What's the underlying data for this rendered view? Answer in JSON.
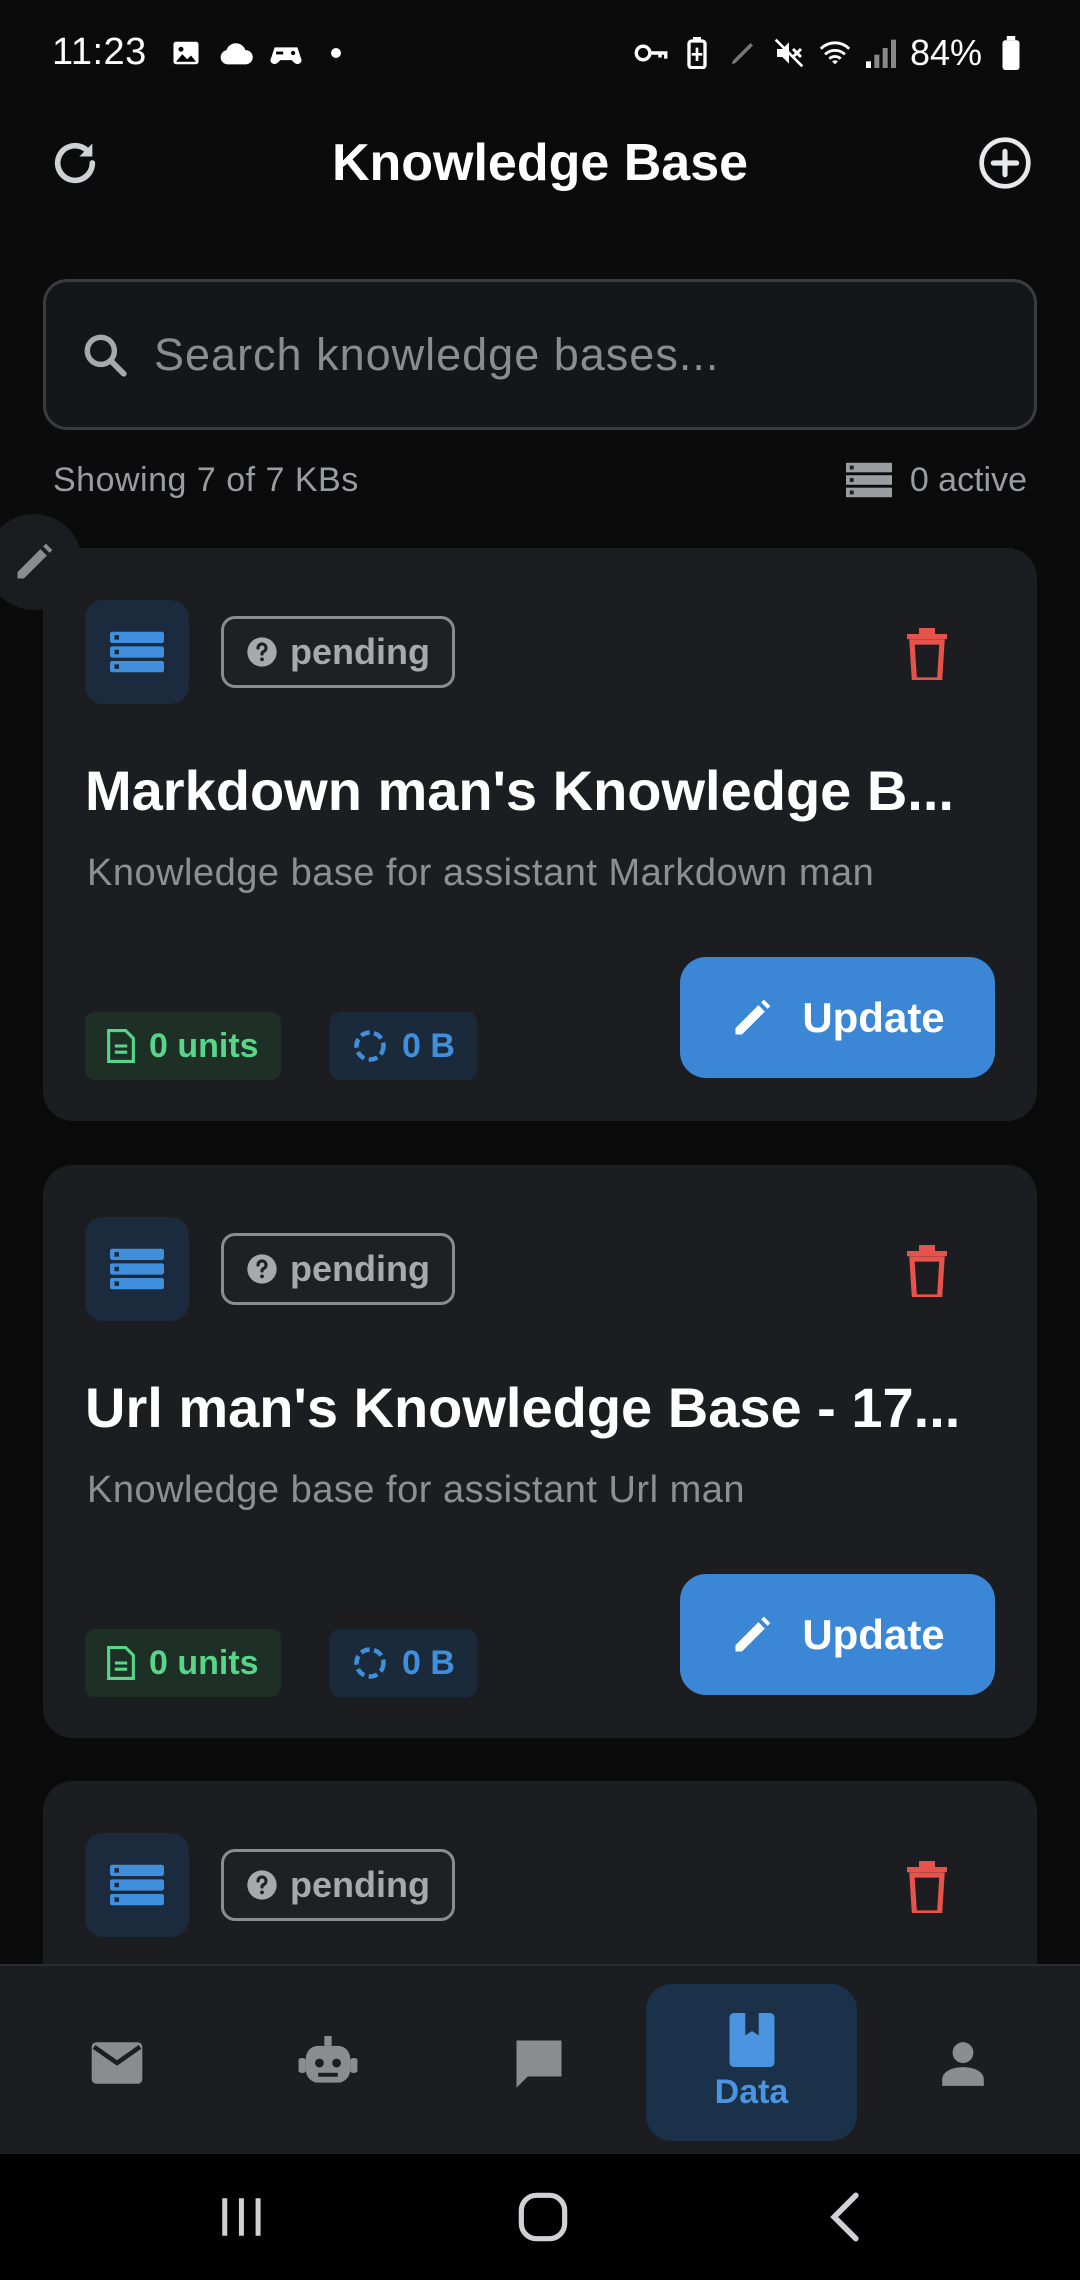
{
  "status_bar": {
    "time": "11:23",
    "battery": "84%"
  },
  "header": {
    "title": "Knowledge Base"
  },
  "search": {
    "placeholder": "Search knowledge bases..."
  },
  "meta": {
    "showing": "Showing 7 of 7 KBs",
    "active": "0 active"
  },
  "cards": [
    {
      "status": "pending",
      "title": "Markdown man's Knowledge B...",
      "description": "Knowledge base for assistant Markdown man",
      "units": "0 units",
      "size": "0 B",
      "update_label": "Update"
    },
    {
      "status": "pending",
      "title": "Url man's Knowledge Base - 17...",
      "description": "Knowledge base for assistant Url man",
      "units": "0 units",
      "size": "0 B",
      "update_label": "Update"
    },
    {
      "status": "pending"
    }
  ],
  "bottom_nav": {
    "items": [
      {
        "icon": "mail-icon",
        "label": ""
      },
      {
        "icon": "robot-icon",
        "label": ""
      },
      {
        "icon": "chat-icon",
        "label": ""
      },
      {
        "icon": "book-icon",
        "label": "Data",
        "active": true
      },
      {
        "icon": "person-icon",
        "label": ""
      }
    ]
  },
  "colors": {
    "accent": "#3b87d6",
    "danger": "#e5534b",
    "success": "#57d68a",
    "card": "#1c1d21",
    "background": "#0b0b0c"
  }
}
